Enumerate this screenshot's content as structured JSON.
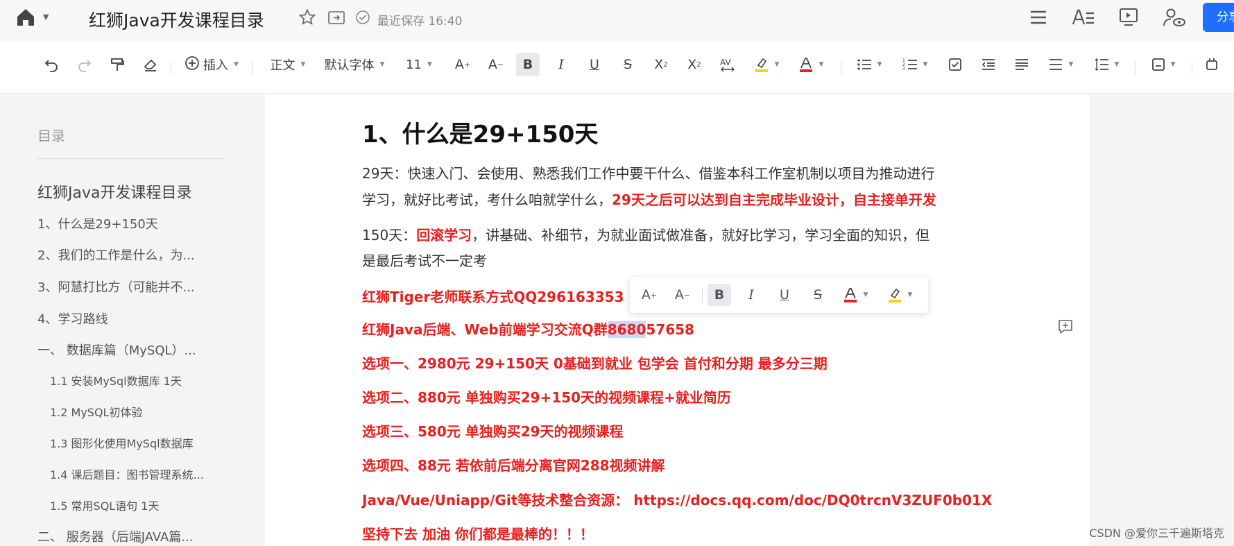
{
  "header": {
    "doc_title": "红狮Java开发课程目录",
    "save_status": "最近保存 16:40",
    "share_label": "分享"
  },
  "toolbar": {
    "insert_label": "插入",
    "paragraph_style": "正文",
    "font_family": "默认字体",
    "font_size": "11"
  },
  "sidebar": {
    "label": "目录",
    "items": [
      {
        "text": "红狮Java开发课程目录"
      },
      {
        "text": "1、什么是29+150天"
      },
      {
        "text": "2、我们的工作是什么，为..."
      },
      {
        "text": "3、阿慧打比方（可能并不..."
      },
      {
        "text": "4、学习路线"
      },
      {
        "text": "一、 数据库篇（MySQL）..."
      },
      {
        "text": "1.1 安装MySql数据库 1天"
      },
      {
        "text": "1.2 MySQL初体验"
      },
      {
        "text": "1.3 图形化使用MySql数据库"
      },
      {
        "text": "1.4 课后题目：图书管理系统..."
      },
      {
        "text": "1.5 常用SQL语句 1天"
      },
      {
        "text": "二、 服务器（后端JAVA篇..."
      }
    ]
  },
  "document": {
    "heading": "1、什么是29+150天",
    "p1_line1": "29天：快速入门、会使用、熟悉我们工作中要干什么、借鉴本科工作室机制以项目为推动进行",
    "p1_line2_plain": "学习，就好比考试，考什么咱就学什么，",
    "p1_line2_red": "29天之后可以达到自主完成毕业设计，自主接单开发",
    "p2_prefix": "150天：",
    "p2_red": "回滚学习",
    "p2_rest": "，讲基础、补细节，为就业面试做准备，就好比学习，学习全面的知识，但",
    "p2_line2": "是最后考试不一定考",
    "contact_qq": "红狮Tiger老师联系方式QQ296163353",
    "group_prefix": "红狮Java后端、Web前端学习交流Q群",
    "group_selected": "8680",
    "group_rest": "57658",
    "option1": "选项一、2980元 29+150天 0基础到就业 包学会 首付和分期 最多分三期",
    "option2": "选项二、880元 单独购买29+150天的视频课程+就业简历",
    "option3": "选项三、580元 单独购买29天的视频课程",
    "option4": "选项四、88元 若依前后端分离官网288视频讲解",
    "resources": "Java/Vue/Uniapp/Git等技术整合资源： https://docs.qq.com/doc/DQ0trcnV3ZUF0b01X",
    "closing": "坚持下去 加油 你们都是最棒的！！！"
  },
  "watermark": "CSDN @爱你三千遍斯塔克",
  "colors": {
    "accent": "#1e6fff",
    "emphasis_red": "#e8201e",
    "selection": "#c9d9f8",
    "highlight_yellow": "#f5d400"
  },
  "icons": [
    "home-icon",
    "star-icon",
    "move-icon",
    "check-circle-icon",
    "menu-icon",
    "text-format-icon",
    "present-icon",
    "user-view-icon",
    "undo-icon",
    "redo-icon",
    "format-painter-icon",
    "eraser-icon",
    "plus-circle-icon",
    "increase-font-icon",
    "decrease-font-icon",
    "bold-icon",
    "italic-icon",
    "underline-icon",
    "strikethrough-icon",
    "subscript-icon",
    "superscript-icon",
    "char-spacing-icon",
    "highlight-icon",
    "font-color-icon",
    "bullet-list-icon",
    "numbered-list-icon",
    "checklist-icon",
    "outdent-icon",
    "indent-icon",
    "align-icon",
    "line-spacing-icon",
    "page-setup-icon",
    "plugin-icon",
    "add-comment-icon"
  ]
}
